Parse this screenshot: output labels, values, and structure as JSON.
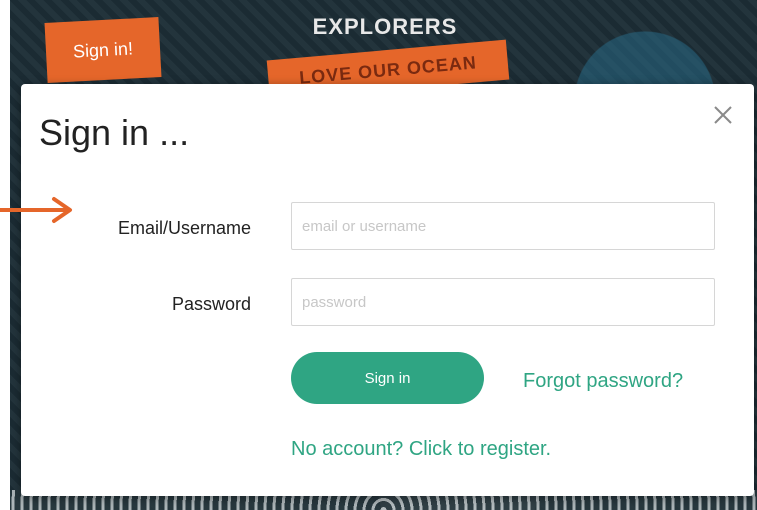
{
  "header": {
    "signin_tab": "Sign in!",
    "logo_text": "EXPLORERS",
    "banner_text": "LOVE OUR OCEAN"
  },
  "modal": {
    "title": "Sign in ...",
    "close_icon": "close-icon",
    "email_label": "Email/Username",
    "email_placeholder": "email or username",
    "email_value": "",
    "password_label": "Password",
    "password_placeholder": "password",
    "password_value": "",
    "signin_button": "Sign in",
    "forgot_link": "Forgot password?",
    "register_link": "No account? Click to register."
  },
  "colors": {
    "accent_green": "#2fa583",
    "accent_orange": "#e5662a"
  }
}
